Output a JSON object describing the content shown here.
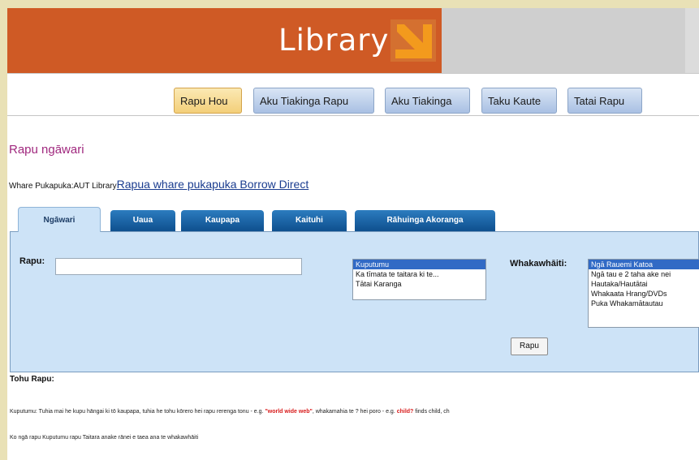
{
  "banner": {
    "logo_text": "Library"
  },
  "nav": {
    "buttons": [
      "Rapu Hou",
      "Aku Tiakinga Rapu",
      "Aku Tiakinga",
      "Taku Kaute",
      "Tatai Rapu"
    ]
  },
  "page_title": "Rapu ngāwari",
  "library": {
    "label": "Whare Pukapuka:AUT Library",
    "link": "Rapua whare pukapuka Borrow Direct"
  },
  "tabs": [
    "Ngāwari",
    "Uaua",
    "Kaupapa",
    "Kaituhi",
    "Rāhuinga Akoranga"
  ],
  "search": {
    "label": "Rapu:",
    "input_value": "",
    "search_types": [
      "Kuputumu",
      "Ka tīmata te taitara ki te...",
      "Tātai Karanga"
    ],
    "filter_label": "Whakawhāiti:",
    "filters": [
      "Ngā Rauemi Katoa",
      "Ngā tau e 2 taha ake nei",
      "Hautaka/Hautātai",
      "Whakaata Hrang/DVDs",
      "Puka Whakamātautau"
    ],
    "button_label": "Rapu"
  },
  "tips": {
    "title": "Tohu Rapu:",
    "line1_before": "Kuputumu: Tuhia mai he kupu hāngai ki tō kaupapa, tuhia he tohu kōrero hei rapu rerenga tonu - e.g. ",
    "line1_red1": "\"world wide web\"",
    "line1_mid": ", whakamahia te ? hei poro - e.g. ",
    "line1_red2": "child?",
    "line1_after": " finds child, ch",
    "line2": "Ko ngā rapu Kuputumu rapu Taitara anake rānei e taea ana te whakawhāiti"
  },
  "colors": {
    "banner_orange": "#cf5a25",
    "title_purple": "#a0287e",
    "tab_blue": "#0e4f8e",
    "panel_bg": "#cde3f7",
    "highlight": "#d81c1c"
  }
}
